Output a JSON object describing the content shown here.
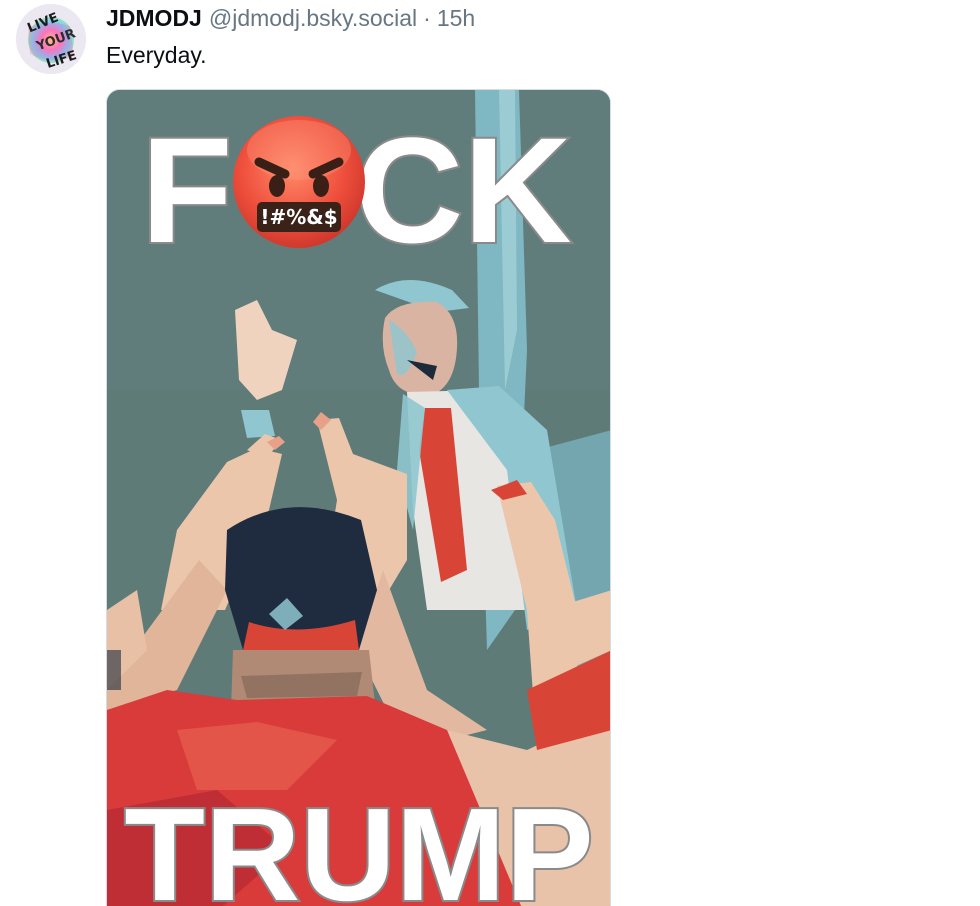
{
  "post": {
    "display_name": "JDMODJ",
    "handle": "@jdmodj.bsky.social",
    "separator": "·",
    "timestamp": "15h",
    "text": "Everyday."
  },
  "avatar": {
    "icon": "avatar-image",
    "text_lines": [
      "LIVE",
      "YOUR",
      "LIFE"
    ]
  },
  "image": {
    "top_text_left": "F",
    "top_text_right": "CK",
    "emoji_text": "!#%&$",
    "bottom_text": "TRUMP",
    "emoji_icon": "angry-face-with-symbols-icon",
    "colors": {
      "background": "#5e7a77",
      "red_shirt": "#d93a3a",
      "teal": "#8fc6cf",
      "skin": "#e8c3a8",
      "cap": "#1f2b3e",
      "text_fill": "#ffffff",
      "text_stroke": "#8a8a8a",
      "emoji": "#e8563f"
    }
  }
}
